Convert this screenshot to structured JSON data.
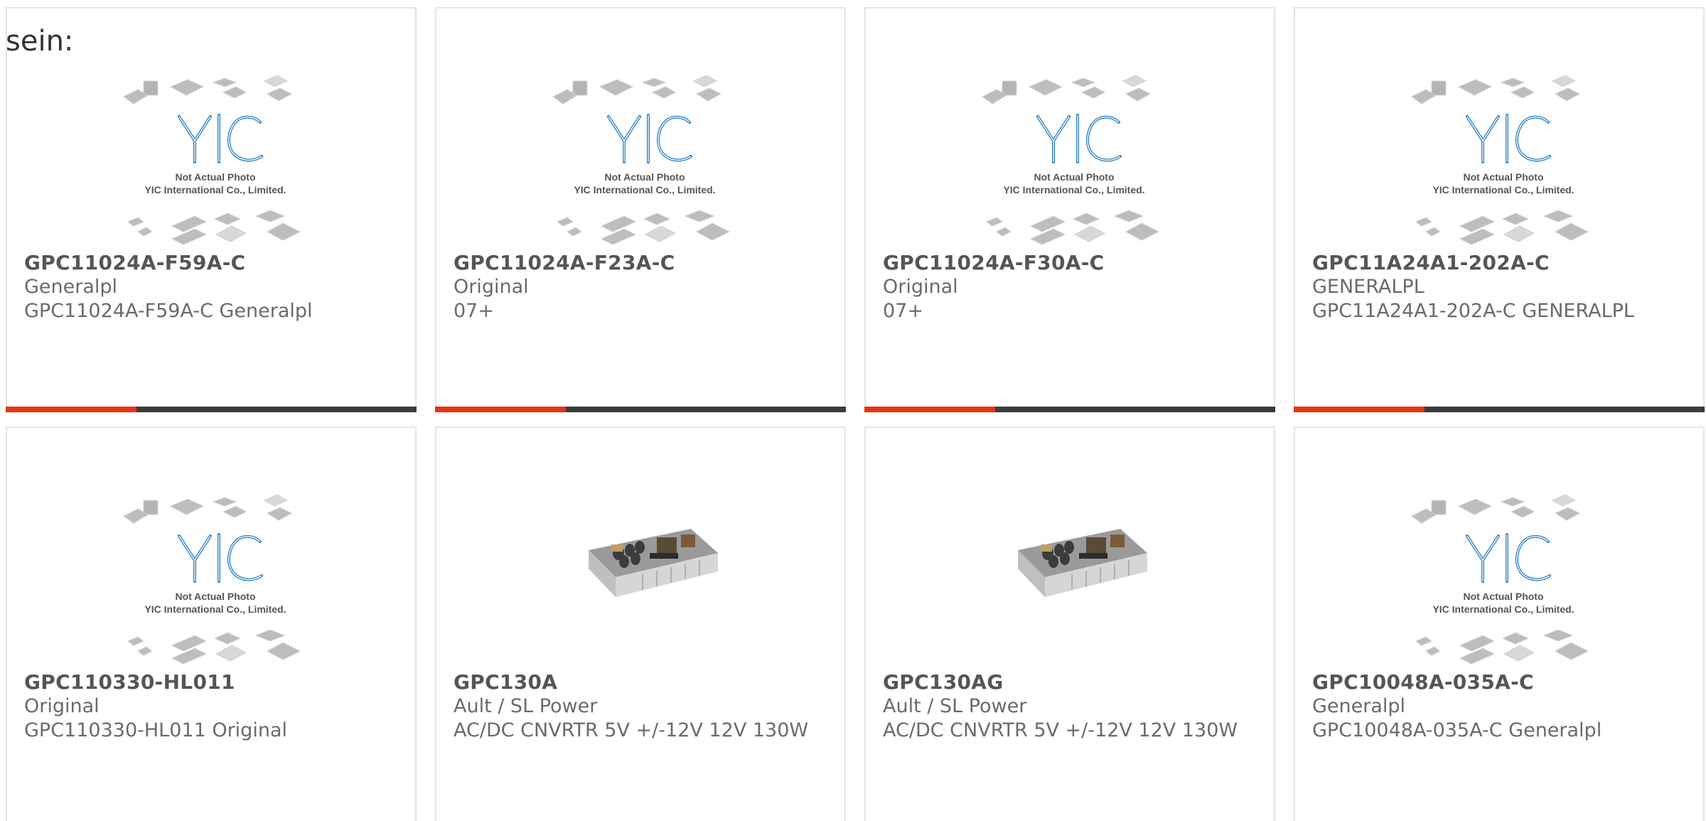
{
  "heading": "sein:",
  "placeholder": {
    "line1": "Not Actual Photo",
    "line2": "YIC International Co., Limited."
  },
  "products": [
    {
      "part": "GPC11024A-F59A-C",
      "brand": "Generalpl",
      "desc": "GPC11024A-F59A-C Generalpl",
      "image": "yic-placeholder"
    },
    {
      "part": "GPC11024A-F23A-C",
      "brand": "Original",
      "desc": "07+",
      "image": "yic-placeholder"
    },
    {
      "part": "GPC11024A-F30A-C",
      "brand": "Original",
      "desc": "07+",
      "image": "yic-placeholder"
    },
    {
      "part": "GPC11A24A1-202A-C",
      "brand": "GENERALPL",
      "desc": "GPC11A24A1-202A-C GENERALPL",
      "image": "yic-placeholder"
    },
    {
      "part": "GPC110330-HL011",
      "brand": "Original",
      "desc": "GPC110330-HL011 Original",
      "image": "yic-placeholder"
    },
    {
      "part": "GPC130A",
      "brand": "Ault / SL Power",
      "desc": "AC/DC CNVRTR 5V +/-12V 12V 130W",
      "image": "power-supply-photo"
    },
    {
      "part": "GPC130AG",
      "brand": "Ault / SL Power",
      "desc": "AC/DC CNVRTR 5V +/-12V 12V 130W",
      "image": "power-supply-photo"
    },
    {
      "part": "GPC10048A-035A-C",
      "brand": "Generalpl",
      "desc": "GPC10048A-035A-C Generalpl",
      "image": "yic-placeholder"
    }
  ],
  "colors": {
    "accent": "#e63312",
    "bar": "#3b3b3b",
    "logo": "#2a7fc1",
    "border": "#e4e4e4"
  }
}
